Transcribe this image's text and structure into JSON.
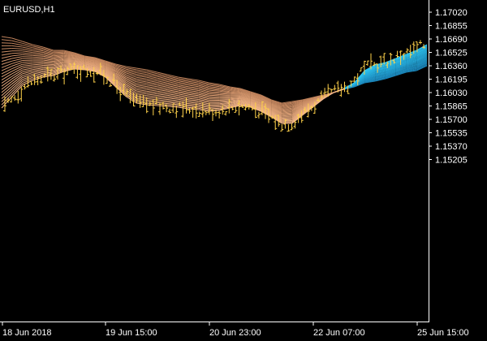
{
  "chart_data": {
    "type": "candlestick-bars-with-ma-ribbon",
    "symbol_label": "EURUSD,H1",
    "grid": false,
    "y_ticks": [
      "1.17020",
      "1.16855",
      "1.16690",
      "1.16525",
      "1.16360",
      "1.16195",
      "1.16030",
      "1.15865",
      "1.15700",
      "1.15535",
      "1.15370",
      "1.15205"
    ],
    "x_ticks": [
      "18 Jun 2018",
      "19 Jun 15:00",
      "20 Jun 23:00",
      "22 Jun 07:00",
      "25 Jun 15:00"
    ],
    "ylim": [
      1.151,
      1.1708
    ],
    "bars_count": 128,
    "bar_color": "#ffd24a",
    "ribbon": {
      "lines": 24,
      "down_color": "#f7b98c",
      "up_color": "#2ec6f2",
      "fastest": [
        1.1584,
        1.1598,
        1.1612,
        1.1618,
        1.1622,
        1.1624,
        1.1629,
        1.1632,
        1.1631,
        1.1629,
        1.1622,
        1.161,
        1.1598,
        1.159,
        1.1588,
        1.1587,
        1.1586,
        1.1585,
        1.1583,
        1.1582,
        1.158,
        1.1581,
        1.1584,
        1.1587,
        1.1585,
        1.158,
        1.1573,
        1.1565,
        1.1565,
        1.1575,
        1.1585,
        1.1595,
        1.1603,
        1.1608,
        1.1615,
        1.163,
        1.1637,
        1.164,
        1.1645,
        1.165,
        1.1655,
        1.1662
      ],
      "slowest": [
        1.1672,
        1.167,
        1.1666,
        1.1662,
        1.1659,
        1.1655,
        1.1655,
        1.1652,
        1.1648,
        1.1646,
        1.1642,
        1.1638,
        1.1635,
        1.1633,
        1.1631,
        1.1628,
        1.1625,
        1.1622,
        1.162,
        1.1618,
        1.1615,
        1.1613,
        1.161,
        1.1608,
        1.1604,
        1.16,
        1.1594,
        1.159,
        1.1592,
        1.1594,
        1.1597,
        1.16,
        1.1603,
        1.1607,
        1.161,
        1.1615,
        1.1617,
        1.162,
        1.1624,
        1.1628,
        1.163,
        1.1636
      ]
    }
  }
}
